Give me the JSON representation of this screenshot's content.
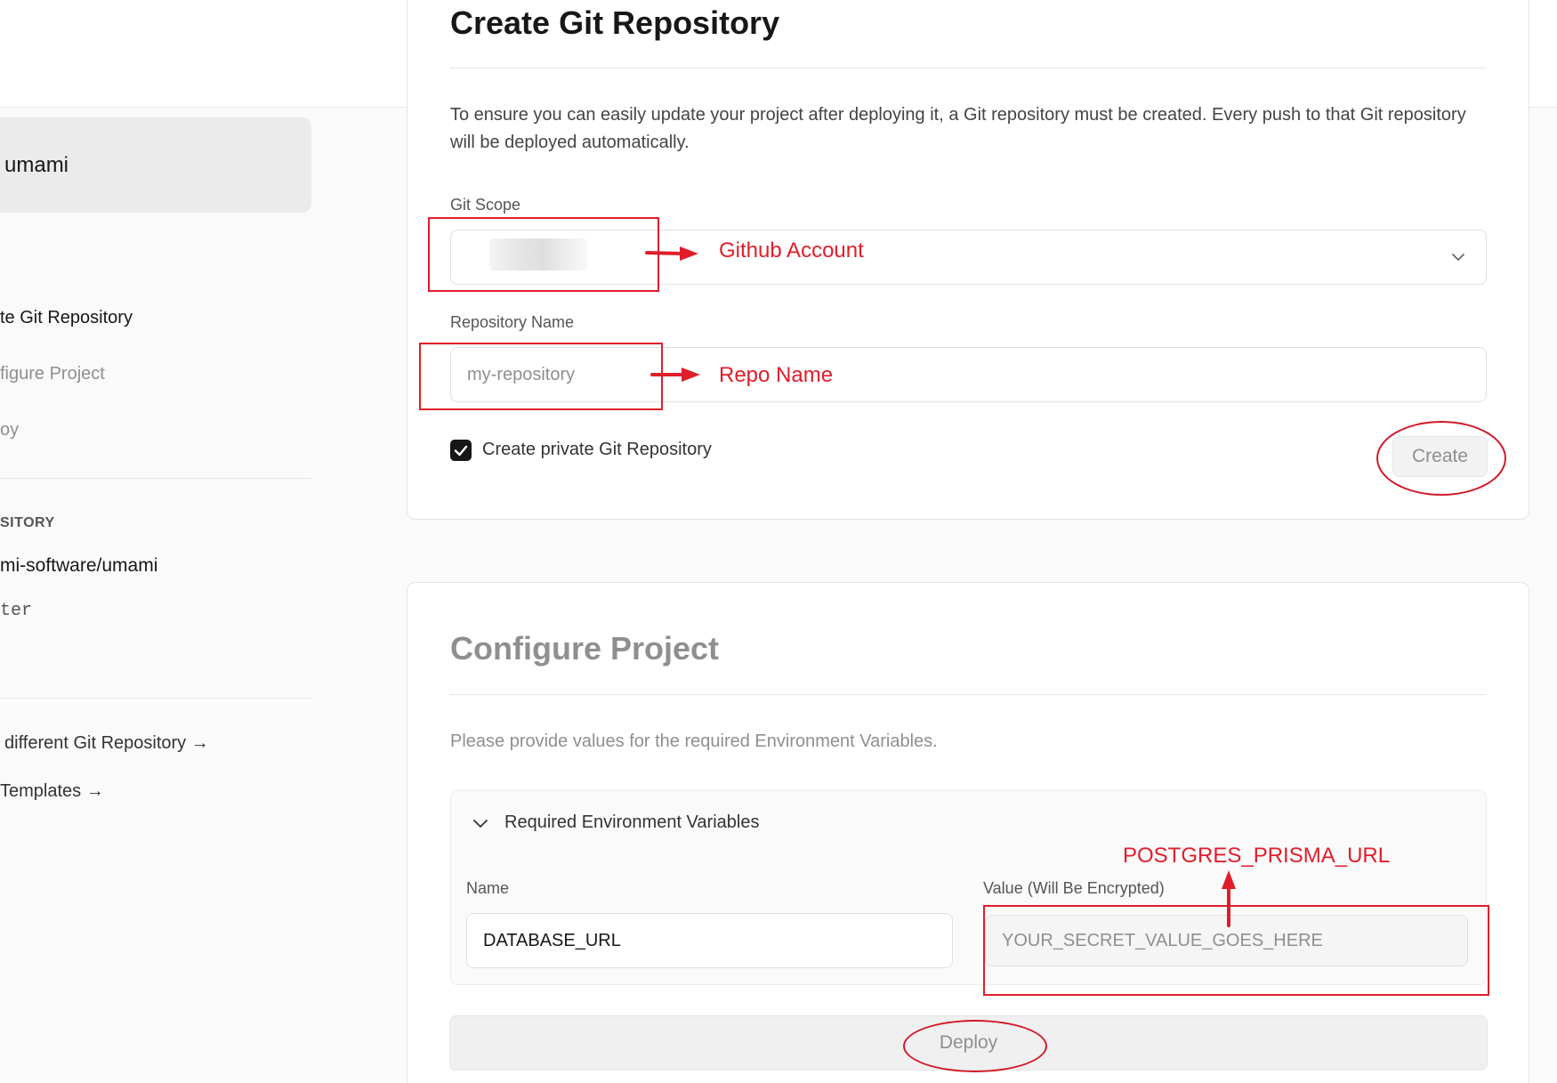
{
  "sidebar": {
    "project_name": "umami",
    "steps": [
      {
        "label": "te Git Repository",
        "state": "active"
      },
      {
        "label": "figure Project",
        "state": "inactive"
      },
      {
        "label": "oy",
        "state": "inactive"
      }
    ],
    "repository_heading": "SITORY",
    "repository_name": "mi-software/umami",
    "branch": "ter",
    "links": [
      {
        "label": "different Git Repository →"
      },
      {
        "label": "Templates →"
      }
    ]
  },
  "create_repo": {
    "title": "Create Git Repository",
    "description": "To ensure you can easily update your project after deploying it, a Git repository must be created. Every push to that Git repository will be deployed automatically.",
    "git_scope_label": "Git Scope",
    "git_scope_icon": "chevron-down-icon",
    "repo_name_label": "Repository Name",
    "repo_name_placeholder": "my-repository",
    "private_checkbox_label": "Create private Git Repository",
    "private_checked": true,
    "create_button": "Create"
  },
  "configure_project": {
    "title": "Configure Project",
    "description": "Please provide values for the required Environment Variables.",
    "env_section_title": "Required Environment Variables",
    "name_label": "Name",
    "value_label": "Value (Will Be Encrypted)",
    "name_value": "DATABASE_URL",
    "value_placeholder": "YOUR_SECRET_VALUE_GOES_HERE",
    "deploy_button": "Deploy"
  },
  "annotations": {
    "color": "#e11d2a",
    "github_account": "Github Account",
    "repo_name": "Repo Name",
    "postgres_url": "POSTGRES_PRISMA_URL"
  }
}
